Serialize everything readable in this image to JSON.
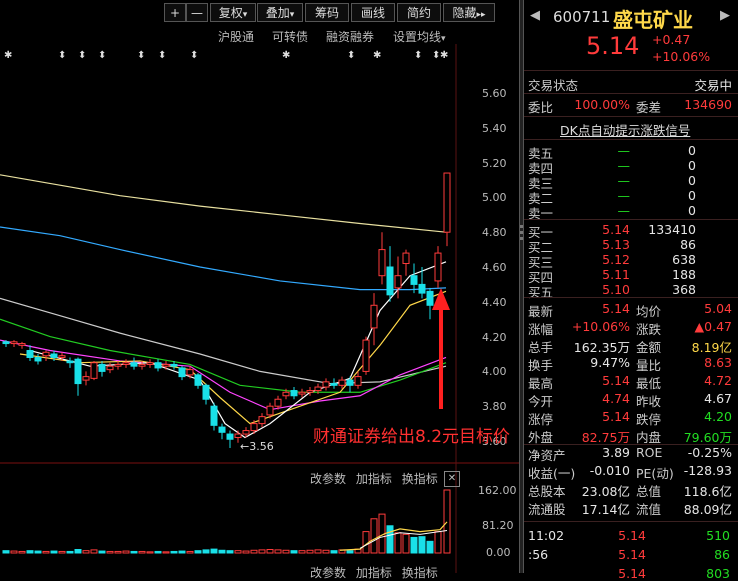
{
  "toolbar": {
    "plus": "+",
    "minus": "—",
    "fuquan": "复权",
    "fuquan_arrow": "▾",
    "diejia": "叠加",
    "diejia_arrow": "▾",
    "chouma": "筹码",
    "huaxian": "画线",
    "jianyue": "简约",
    "yincang": "隐藏",
    "more": "▸▸"
  },
  "subbar": {
    "hgt": "沪股通",
    "kzz": "可转债",
    "rzrq": "融资融券",
    "szjx": "设置均线",
    "szjx_arrow": "▾"
  },
  "markers": [
    "✱",
    "⬍",
    "⬍",
    "⬍",
    "⬍",
    "⬍",
    "⬍",
    "✱",
    "⬍",
    "✱",
    "⬍",
    "⬍",
    "✱"
  ],
  "price_axis": [
    "5.60",
    "5.40",
    "5.20",
    "5.00",
    "4.80",
    "4.60",
    "4.40",
    "4.20",
    "4.00",
    "3.80",
    "3.60"
  ],
  "low_label": "3.56",
  "overlay_text": "财通证券给出8.2元目标价",
  "indicator_bar": {
    "gcs": "改参数",
    "jzb": "加指标",
    "hzb": "换指标",
    "close": "✕"
  },
  "indicator_bar2": {
    "gcs": "改参数",
    "jzb": "加指标",
    "hzb": "换指标"
  },
  "volume_axis": [
    "162.00",
    "81.20",
    "0.00"
  ],
  "stock": {
    "code": "600711",
    "name": "盛屯矿业",
    "price": "5.14",
    "change": "+0.47",
    "change_pct": "+10.06%",
    "left_arrow": "◀",
    "right_arrow": "▶"
  },
  "status": {
    "label": "交易状态",
    "value": "交易中"
  },
  "weibi": {
    "label": "委比",
    "value": "100.00%",
    "cha_label": "委差",
    "cha_value": "134690"
  },
  "dk_signal": "DK点自动提示涨跌信号",
  "asks": [
    {
      "label": "卖五",
      "price": "—",
      "vol": "0"
    },
    {
      "label": "卖四",
      "price": "—",
      "vol": "0"
    },
    {
      "label": "卖三",
      "price": "—",
      "vol": "0"
    },
    {
      "label": "卖二",
      "price": "—",
      "vol": "0"
    },
    {
      "label": "卖一",
      "price": "—",
      "vol": "0"
    }
  ],
  "bids": [
    {
      "label": "买一",
      "price": "5.14",
      "vol": "133410"
    },
    {
      "label": "买二",
      "price": "5.13",
      "vol": "86"
    },
    {
      "label": "买三",
      "price": "5.12",
      "vol": "638"
    },
    {
      "label": "买四",
      "price": "5.11",
      "vol": "188"
    },
    {
      "label": "买五",
      "price": "5.10",
      "vol": "368"
    }
  ],
  "stats": [
    {
      "l1": "最新",
      "v1": "5.14",
      "c1": "red",
      "l2": "均价",
      "v2": "5.04",
      "c2": "red"
    },
    {
      "l1": "涨幅",
      "v1": "+10.06%",
      "c1": "red",
      "l2": "涨跌",
      "v2": "▲0.47",
      "c2": "red"
    },
    {
      "l1": "总手",
      "v1": "162.35万",
      "c1": "white",
      "l2": "金额",
      "v2": "8.19亿",
      "c2": "yellow"
    },
    {
      "l1": "换手",
      "v1": "9.47%",
      "c1": "white",
      "l2": "量比",
      "v2": "8.63",
      "c2": "red"
    },
    {
      "l1": "最高",
      "v1": "5.14",
      "c1": "red",
      "l2": "最低",
      "v2": "4.72",
      "c2": "red"
    },
    {
      "l1": "今开",
      "v1": "4.74",
      "c1": "red",
      "l2": "昨收",
      "v2": "4.67",
      "c2": "white"
    },
    {
      "l1": "涨停",
      "v1": "5.14",
      "c1": "red",
      "l2": "跌停",
      "v2": "4.20",
      "c2": "green"
    },
    {
      "l1": "外盘",
      "v1": "82.75万",
      "c1": "red",
      "l2": "内盘",
      "v2": "79.60万",
      "c2": "green"
    },
    {
      "l1": "净资产",
      "v1": "3.89",
      "c1": "white",
      "l2": "ROE",
      "v2": "-0.25%",
      "c2": "white"
    },
    {
      "l1": "收益(一)",
      "v1": "-0.010",
      "c1": "white",
      "l2": "PE(动)",
      "v2": "-128.93",
      "c2": "white"
    },
    {
      "l1": "总股本",
      "v1": "23.08亿",
      "c1": "white",
      "l2": "总值",
      "v2": "118.6亿",
      "c2": "white"
    },
    {
      "l1": "流通股",
      "v1": "17.14亿",
      "c1": "white",
      "l2": "流值",
      "v2": "88.09亿",
      "c2": "white"
    }
  ],
  "ticks": [
    {
      "time": "11:02",
      "price": "5.14",
      "vol": "510"
    },
    {
      "time": ":56",
      "price": "5.14",
      "vol": "86"
    },
    {
      "time": "",
      "price": "5.14",
      "vol": "803"
    }
  ],
  "colors": {
    "up": "#ff3b3b",
    "down": "#19e0e8",
    "ma5": "#ffffff",
    "ma10": "#ffd84a",
    "ma20": "#ff44ff",
    "ma30": "#22cc22",
    "ma60": "#cccccc",
    "ma120": "#33aaff",
    "ma250": "#e8e0a0"
  }
}
